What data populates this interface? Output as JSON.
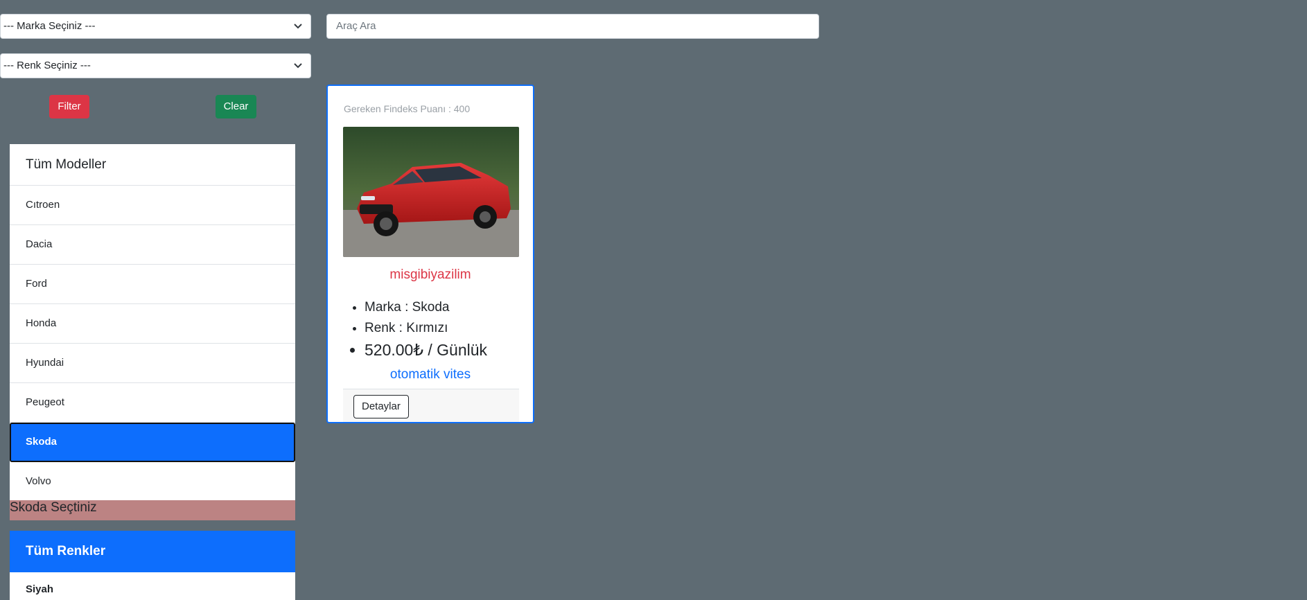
{
  "filters": {
    "brand_select": "--- Marka Seçiniz ---",
    "color_select": "--- Renk Seçiniz ---",
    "search_placeholder": "Araç Ara",
    "filter_label": "Filter",
    "clear_label": "Clear",
    "filter_color": "#dc3545",
    "clear_color": "#198754"
  },
  "models": {
    "header": "Tüm Modeller",
    "items": [
      "Cıtroen",
      "Dacia",
      "Ford",
      "Honda",
      "Hyundai",
      "Peugeot",
      "Skoda",
      "Volvo"
    ],
    "active": "Skoda",
    "active_color": "#0d6efd"
  },
  "selected_message": "Skoda Seçtiniz",
  "colors": {
    "header": "Tüm Renkler",
    "items": [
      "Siyah"
    ]
  },
  "car": {
    "findeks": "Gereken Findeks Puanı : 400",
    "image_icon": "red-skoda-car-photo",
    "title": "misgibiyazilim",
    "brand": "Marka : Skoda",
    "color": "Renk : Kırmızı",
    "price": "520.00₺ / Günlük",
    "gear": "otomatik vites",
    "details_label": "Detaylar"
  }
}
